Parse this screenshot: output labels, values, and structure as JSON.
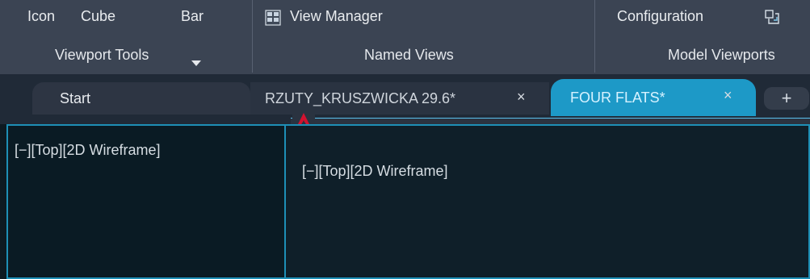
{
  "ribbon": {
    "top_labels": [
      "Icon",
      "Cube",
      "Bar"
    ],
    "view_manager_label": "View Manager",
    "configuration_label": "Configuration",
    "viewport_tools_label": "Viewport Tools",
    "named_views_label": "Named Views",
    "model_viewports_label": "Model Viewports",
    "colors": {
      "ribbon_bg": "#3b4453",
      "accent": "#1d99c7"
    }
  },
  "tabs": [
    {
      "label": "Start"
    },
    {
      "label": "RZUTY_KRUSZWICKA 29.6*",
      "close": "×"
    },
    {
      "label": "FOUR FLATS*",
      "close": "×",
      "active": true
    }
  ],
  "tab_plus": "+",
  "viewports": {
    "left_title": "[−][Top][2D Wireframe]",
    "right_title": "[−][Top][2D Wireframe]"
  },
  "icons": {
    "dropdown_icon": "chevron-down-icon",
    "view_manager_icon": "view-manager-icon",
    "configuration_icon": "configuration-icon",
    "app_logo": "autocad-logo-icon"
  }
}
